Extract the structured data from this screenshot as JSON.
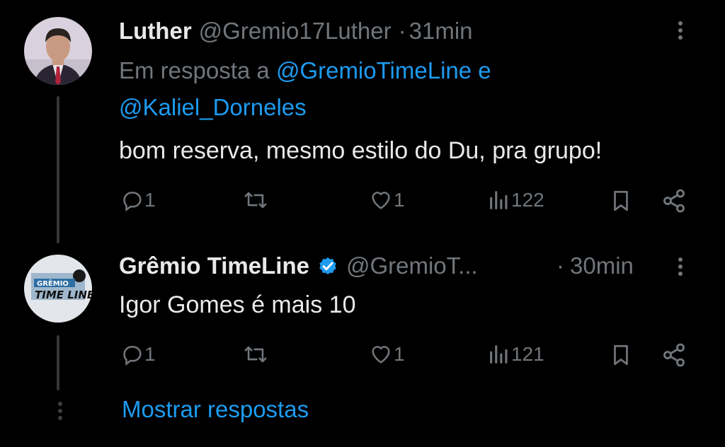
{
  "tweet1": {
    "name": "Luther",
    "handle": "@Gremio17Luther",
    "separator": "·",
    "time": "31min",
    "reply_prefix": "Em resposta a",
    "reply_to_1": "@GremioTimeLine",
    "reply_conj": "e",
    "reply_to_2": "@Kaliel_Dorneles",
    "text": "bom reserva, mesmo estilo do Du, pra grupo!",
    "replies": "1",
    "retweets": "",
    "likes": "1",
    "views": "122"
  },
  "tweet2": {
    "name": "Grêmio TimeLine",
    "verified": true,
    "handle": "@GremioT...",
    "separator": "·",
    "time": "30min",
    "text": "Igor Gomes é mais 10",
    "replies": "1",
    "retweets": "",
    "likes": "1",
    "views": "121",
    "avatar_logo_line1": "GRÊMIO",
    "avatar_logo_line2": "TIME LINE"
  },
  "show_replies_label": "Mostrar respostas",
  "icons": {
    "reply": "speech-bubble-icon",
    "retweet": "retweet-icon",
    "like": "heart-icon",
    "views": "bar-chart-icon",
    "bookmark": "bookmark-icon",
    "share": "share-icon",
    "more": "vertical-ellipsis-icon",
    "verified": "verified-badge-icon"
  },
  "colors": {
    "background": "#000000",
    "text": "#e7e9ea",
    "secondary": "#71767b",
    "link": "#1d9bf0",
    "thread_line": "#333639"
  }
}
